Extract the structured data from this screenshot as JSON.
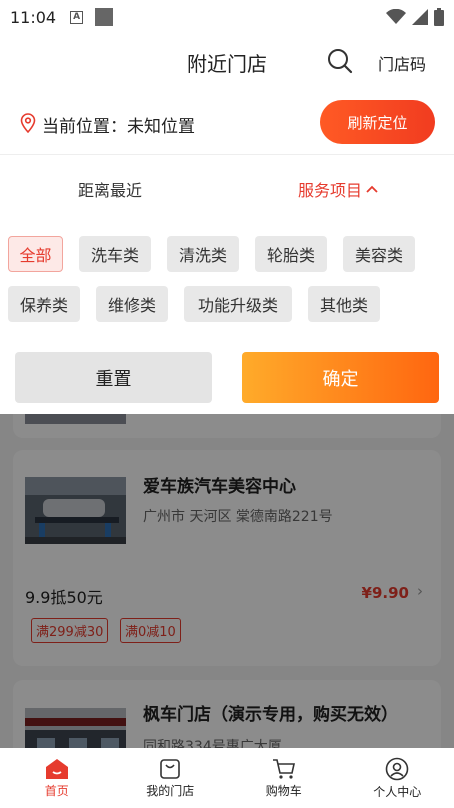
{
  "status_bar": {
    "time": "11:04",
    "a_badge": "A"
  },
  "header": {
    "title": "附近门店",
    "store_code": "门店码"
  },
  "location": {
    "label": "当前位置：未知位置",
    "refresh_button": "刷新定位"
  },
  "filters": {
    "nearest": "距离最近",
    "services": "服务项目"
  },
  "chips": [
    "全部",
    "洗车类",
    "清洗类",
    "轮胎类",
    "美容类",
    "保养类",
    "维修类",
    "功能升级类",
    "其他类"
  ],
  "active_chip": "全部",
  "actions": {
    "reset": "重置",
    "confirm": "确定"
  },
  "stores": [
    {
      "name": "爱车族汽车美容中心",
      "address": "广州市 天河区 棠德南路221号",
      "deal": "9.9抵50元",
      "price": "¥9.90",
      "coupons": [
        "满299减30",
        "满0减10"
      ]
    },
    {
      "name": "枫车门店（演示专用，购买无效）",
      "address": "同和路334号惠广大厦"
    }
  ],
  "bottom_nav": [
    {
      "label": "首页",
      "icon": "home-icon",
      "active": true
    },
    {
      "label": "我的门店",
      "icon": "bag-icon",
      "active": false
    },
    {
      "label": "购物车",
      "icon": "cart-icon",
      "active": false
    },
    {
      "label": "个人中心",
      "icon": "user-icon",
      "active": false
    }
  ],
  "colors": {
    "accent": "#e63b2e",
    "confirm_start": "#ffab2a",
    "confirm_end": "#ff6610"
  }
}
